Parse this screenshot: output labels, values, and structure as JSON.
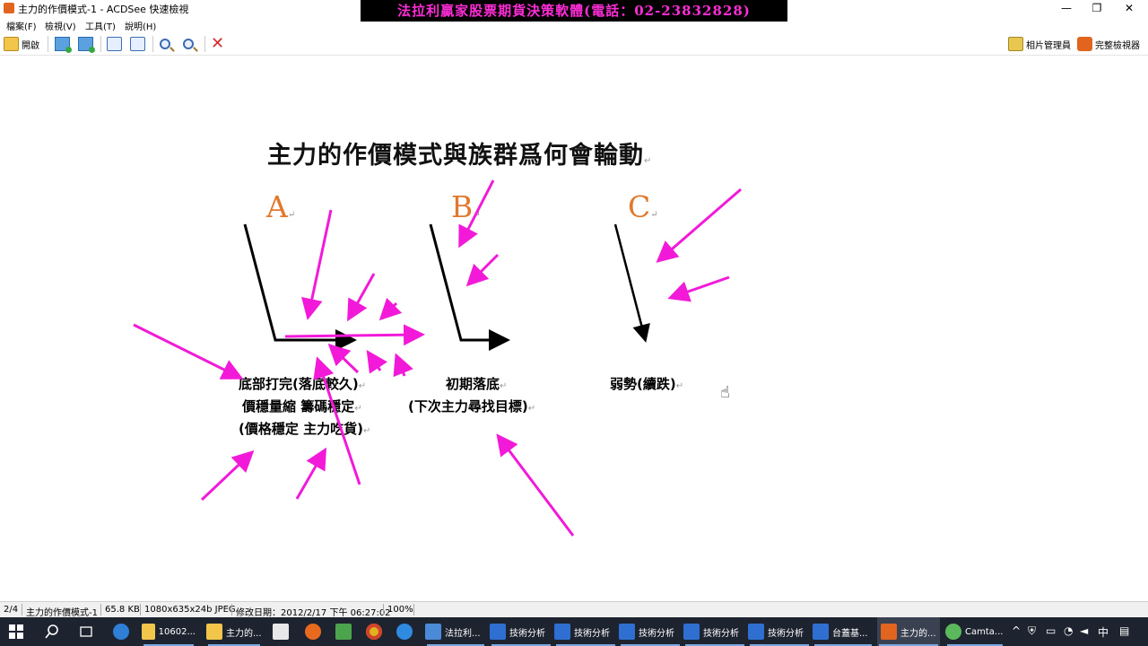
{
  "window": {
    "title": "主力的作價模式-1 - ACDSee 快速檢視",
    "ad_banner": "法拉利贏家股票期貨決策軟體(電話：02-23832828)",
    "controls": {
      "minimize": "—",
      "restore": "❐",
      "close": "✕"
    }
  },
  "menu": [
    "檔案(F)",
    "檢視(V)",
    "工具(T)",
    "說明(H)"
  ],
  "toolbar": {
    "open_label": "開啟",
    "photo_manager_label": "相片管理員",
    "full_viewer_label": "完整檢視器"
  },
  "slide": {
    "title": "主力的作價模式與族群爲何會輪動",
    "panels": [
      {
        "letter": "A",
        "caption_lines": [
          "底部打完(落底較久)",
          "價穩量縮  籌碼穩定",
          "(價格穩定  主力吃貨)"
        ]
      },
      {
        "letter": "B",
        "caption_lines": [
          "初期落底",
          "(下次主力尋找目標)"
        ]
      },
      {
        "letter": "C",
        "caption_lines": [
          "弱勢(續跌)"
        ]
      }
    ],
    "paragraph_mark": "↵"
  },
  "status": {
    "page": "2/4",
    "file_name": "主力的作價模式-1",
    "file_size": "65.8 KB",
    "image_info": "1080x635x24b JPEG",
    "modified": "修改日期：2012/2/17 下午 06:27:02",
    "zoom": "100%"
  },
  "taskbar": {
    "items": [
      {
        "label": "10602...",
        "color": "#f1c64b"
      },
      {
        "label": "主力的...",
        "color": "#f1c64b"
      },
      {
        "label": "法拉利...",
        "color": "#4a8ad6"
      },
      {
        "label": "技術分析",
        "color": "#2f6fd1"
      },
      {
        "label": "技術分析",
        "color": "#2f6fd1"
      },
      {
        "label": "技術分析",
        "color": "#2f6fd1"
      },
      {
        "label": "技術分析",
        "color": "#2f6fd1"
      },
      {
        "label": "技術分析",
        "color": "#2f6fd1"
      },
      {
        "label": "台蓋基...",
        "color": "#2f6fd1"
      },
      {
        "label": "主力的...",
        "color": "#e2651f"
      },
      {
        "label": "Camta...",
        "color": "#5cb85c"
      }
    ],
    "ime": "中"
  },
  "colors": {
    "arrow": "#f21ad8",
    "letter": "#e0782e",
    "ad_text": "#ff2dd8"
  }
}
